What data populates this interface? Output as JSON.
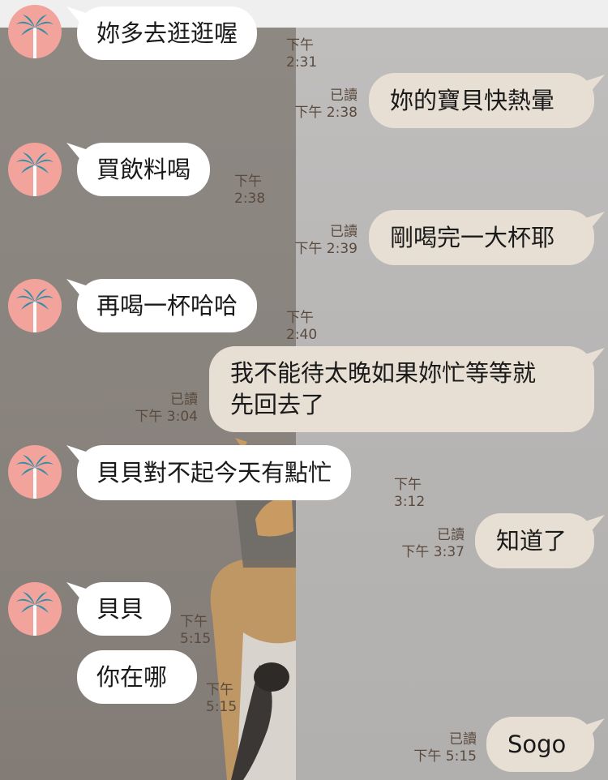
{
  "messages": [
    {
      "side": "in",
      "text": "妳多去逛逛喔",
      "time": "下午 2:31"
    },
    {
      "side": "out",
      "text": "妳的寶貝快熱暈",
      "read": "已讀",
      "time": "下午 2:38"
    },
    {
      "side": "in",
      "text": "買飲料喝",
      "time": "下午 2:38"
    },
    {
      "side": "out",
      "text": "剛喝完一大杯耶",
      "read": "已讀",
      "time": "下午 2:39"
    },
    {
      "side": "in",
      "text": "再喝一杯哈哈",
      "time": "下午 2:40"
    },
    {
      "side": "out",
      "text_lines": [
        "我不能待太晚如果妳忙等等就",
        "先回去了"
      ],
      "read": "已讀",
      "time": "下午 3:04"
    },
    {
      "side": "in",
      "text": "貝貝對不起今天有點忙",
      "time": "下午 3:12"
    },
    {
      "side": "out",
      "text": "知道了",
      "read": "已讀",
      "time": "下午 3:37"
    },
    {
      "side": "in",
      "text": "貝貝",
      "time": "下午 5:15"
    },
    {
      "side": "in",
      "text": "你在哪",
      "time": "下午 5:15"
    },
    {
      "side": "out",
      "text": "Sogo",
      "read": "已讀",
      "time": "下午 5:15"
    }
  ],
  "colors": {
    "incoming_bubble": "#ffffff",
    "outgoing_bubble": "#e7dfd3",
    "avatar_bg": "#f2a39b",
    "avatar_icon": "palm-tree-icon"
  }
}
